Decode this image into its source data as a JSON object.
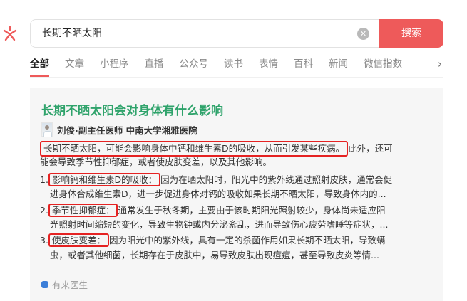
{
  "search": {
    "query": "长期不晒太阳",
    "clear_symbol": "✕",
    "button_label": "搜索"
  },
  "tabs": [
    {
      "label": "全部",
      "active": true
    },
    {
      "label": "文章"
    },
    {
      "label": "小程序"
    },
    {
      "label": "直播"
    },
    {
      "label": "公众号"
    },
    {
      "label": "读书"
    },
    {
      "label": "表情"
    },
    {
      "label": "百科"
    },
    {
      "label": "新闻"
    },
    {
      "label": "微信指数"
    }
  ],
  "tabs_more": "›",
  "card": {
    "title": "长期不晒太阳会对身体有什么影响",
    "author": "刘俊·副主任医师 中南大学湘雅医院",
    "summary_highlight": "长期不晒太阳，可能会影响身体中钙和维生素D的吸收，从而引发某些疾病。",
    "summary_rest_1": "此外，还可",
    "summary_rest_2": "能会导致季节性抑郁症，或者使皮肤变差，以及其他影响。",
    "items": [
      {
        "num": "1.",
        "label": "影响钙和维生素D的吸收：",
        "text_1": "因为在晒太阳时，阳光中的紫外线通过照射皮肤，通常会促",
        "text_2": "进身体合成维生素D，进一步促进身体对钙的吸收如果长期不晒太阳，导致身体内的..."
      },
      {
        "num": "2.",
        "label": "季节性抑郁症：",
        "text_1": "通常发生于秋冬期，主要由于该时期阳光照射较少，身体尚未适应阳",
        "text_2": "光照射时间缩短的变化，导致生物钟或内分泌紊乱，进而导致伤心疲劳嗜睡等症状，..."
      },
      {
        "num": "3.",
        "label": "使皮肤变差：",
        "text_1": "因为阳光中的紫外线，具有一定的杀菌作用如果长期不晒太阳，导致螨",
        "text_2": "虫，或者其他细菌，长期存在于皮肤中，易导致皮肤出现痘痘，甚至导致皮炎等情..."
      }
    ],
    "source": "有来医生"
  },
  "colors": {
    "accent": "#ee5a5a",
    "title_green": "#2fa36b",
    "highlight_red": "#e52222"
  }
}
